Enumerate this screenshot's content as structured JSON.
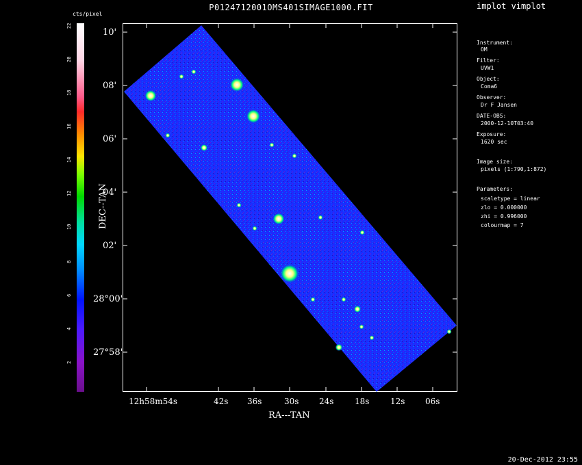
{
  "window": {
    "title": "P0124712001OMS401SIMAGE1000.FIT",
    "program": "implot vimplot",
    "timestamp": "20-Dec-2012 23:55"
  },
  "colorbar": {
    "unit": "cts/pixel",
    "ticks": [
      "22",
      "20",
      "18",
      "16",
      "14",
      "12",
      "10",
      "8",
      "6",
      "4",
      "2"
    ]
  },
  "axes": {
    "x_label": "RA---TAN",
    "y_label": "DEC--TAN",
    "x_ticks": [
      "12h58m54s",
      "42s",
      "36s",
      "30s",
      "24s",
      "18s",
      "12s",
      "06s"
    ],
    "y_ticks": [
      "10'",
      "08'",
      "06'",
      "04'",
      "02'",
      "28°00'",
      "27°58'"
    ]
  },
  "info": {
    "instrument_label": "Instrument:",
    "instrument": "OM",
    "filter_label": "Filter:",
    "filter": "UVW1",
    "object_label": "Object:",
    "object": "Coma6",
    "observer_label": "Observer:",
    "observer": "Dr F Jansen",
    "date_label": "DATE-OBS:",
    "date": "2000-12-10T03:40",
    "exposure_label": "Exposure:",
    "exposure": "1620 sec",
    "image_size_label": "Image size:",
    "image_size": "pixels (1:790,1:872)",
    "parameters_label": "Parameters:",
    "scaletype": "scaletype = linear",
    "zlo": "zlo = 0.000000",
    "zhi": "zhi = 0.996000",
    "colourmap": "colourmap =   7"
  }
}
